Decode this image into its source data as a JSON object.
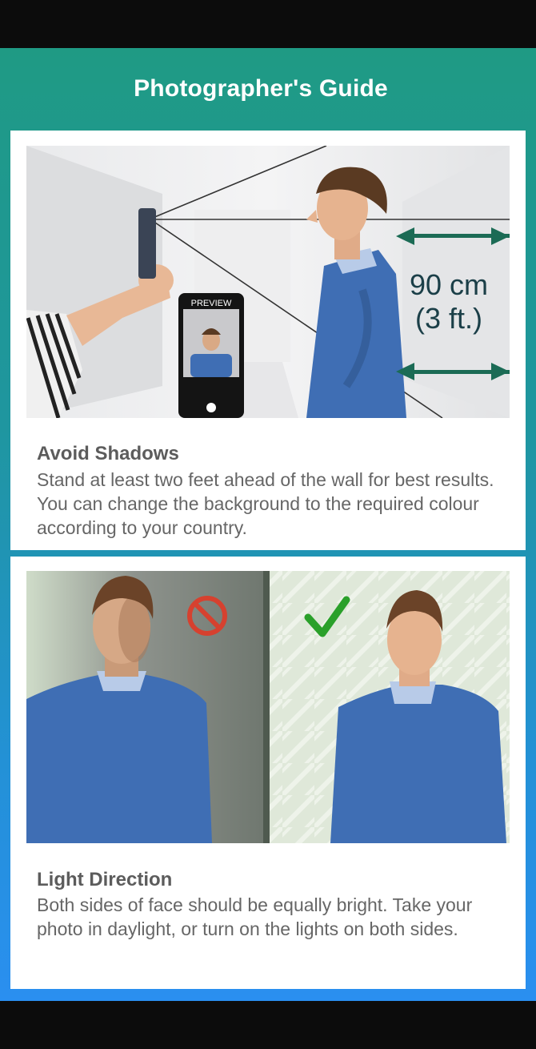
{
  "header": {
    "title": "Photographer's Guide"
  },
  "cards": [
    {
      "heading": "Avoid Shadows",
      "body": "Stand at least two feet ahead of the wall for best results. You can change the background to the required colour according to your country.",
      "image": {
        "preview_label": "PREVIEW",
        "distance_metric": "90 cm",
        "distance_imperial": "(3 ft.)"
      }
    },
    {
      "heading": "Light Direction",
      "body": "Both sides of face should be equally bright. Take your photo in daylight, or turn on the lights on both sides.",
      "image": {
        "wrong_icon": "prohibited-icon",
        "right_icon": "checkmark-icon"
      }
    }
  ],
  "colors": {
    "header_start": "#1f9a84",
    "header_end": "#2a8ff0",
    "sweater": "#3f6eb4",
    "arrow": "#1b6b55",
    "prohibit": "#d6412f",
    "check": "#2aa02a"
  }
}
